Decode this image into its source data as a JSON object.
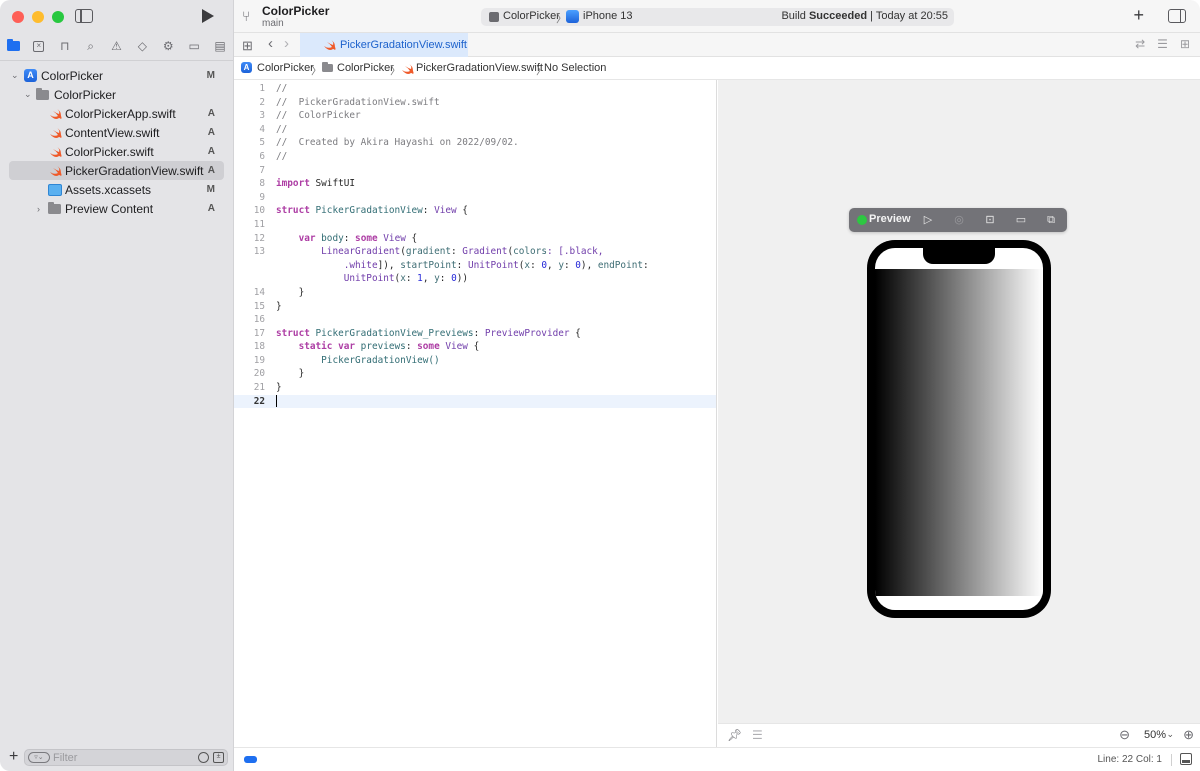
{
  "window": {
    "traffic_lights": [
      "close",
      "minimize",
      "zoom"
    ]
  },
  "toolbar": {
    "project_title": "ColorPicker",
    "branch": "main",
    "scheme": "ColorPicker",
    "device": "iPhone 13",
    "build_prefix": "Build ",
    "build_result": "Succeeded",
    "build_time": " | Today at 20:55",
    "add_label": "+"
  },
  "navigator": {
    "icons": [
      "folder-icon",
      "source-control-icon",
      "symbol-icon",
      "search-icon",
      "issue-icon",
      "test-icon",
      "debug-icon",
      "breakpoint-icon",
      "report-icon"
    ],
    "tree": [
      {
        "label": "ColorPicker",
        "badge": "M",
        "kind": "project",
        "level": 0,
        "expanded": true
      },
      {
        "label": "ColorPicker",
        "badge": "",
        "kind": "folder",
        "level": 1,
        "expanded": true
      },
      {
        "label": "ColorPickerApp.swift",
        "badge": "A",
        "kind": "swift",
        "level": 2
      },
      {
        "label": "ContentView.swift",
        "badge": "A",
        "kind": "swift",
        "level": 2
      },
      {
        "label": "ColorPicker.swift",
        "badge": "A",
        "kind": "swift",
        "level": 2
      },
      {
        "label": "PickerGradationView.swift",
        "badge": "A",
        "kind": "swift",
        "level": 2,
        "selected": true
      },
      {
        "label": "Assets.xcassets",
        "badge": "M",
        "kind": "assets",
        "level": 2
      },
      {
        "label": "Preview Content",
        "badge": "A",
        "kind": "folder",
        "level": 2,
        "expanded": false
      }
    ],
    "filter_placeholder": "Filter"
  },
  "tabs": [
    {
      "label": "PickerGradationView.swift",
      "active": true
    }
  ],
  "jumpbar": {
    "items": [
      "ColorPicker",
      "ColorPicker",
      "PickerGradationView.swift",
      "No Selection"
    ]
  },
  "editor": {
    "current_line": 22,
    "lines": [
      {
        "n": "1"
      },
      {
        "n": "2"
      },
      {
        "n": "3"
      },
      {
        "n": "4"
      },
      {
        "n": "5"
      },
      {
        "n": "6"
      },
      {
        "n": "7"
      },
      {
        "n": "8"
      },
      {
        "n": "9"
      },
      {
        "n": "10"
      },
      {
        "n": "11"
      },
      {
        "n": "12"
      },
      {
        "n": "13"
      },
      {
        "n": ""
      },
      {
        "n": ""
      },
      {
        "n": "14"
      },
      {
        "n": "15"
      },
      {
        "n": "16"
      },
      {
        "n": "17"
      },
      {
        "n": "18"
      },
      {
        "n": "19"
      },
      {
        "n": "20"
      },
      {
        "n": "21"
      },
      {
        "n": "22"
      }
    ],
    "tokens": {
      "c1": "//",
      "c2": "//  PickerGradationView.swift",
      "c3": "//  ColorPicker",
      "c4": "//",
      "c5": "//  Created by Akira Hayashi on 2022/09/02.",
      "c6": "//",
      "import_kw": "import",
      "import_mod": " SwiftUI",
      "struct_kw": "struct",
      "struct_name": " PickerGradationView",
      "colon_sp": ": ",
      "view_ty": "View",
      "brace_open": " {",
      "var_kw": "    var",
      "body_name": " body",
      "some_kw": "some",
      "lg": "        LinearGradient",
      "lg_paren": "(",
      "gradient_lbl": "gradient",
      "gradient_ty": "Gradient",
      "colors_lbl": "colors",
      "black": ": [.black,",
      "white_ind": "            .white",
      "white_close": "]), ",
      "startpoint_lbl": "startPoint",
      "unitpoint_ty": "UnitPoint",
      "x_lbl": "x",
      "y_lbl": "y",
      "zero": "0",
      "one": "1",
      "endpoint_lbl": "endPoint",
      "up2_ind": "            ",
      "close14": "    }",
      "close15": "}",
      "struct2_name": " PickerGradationView_Previews",
      "previewprovider_ty": "PreviewProvider",
      "static_kw": "    static",
      "var2_kw": " var",
      "previews_name": " previews",
      "pgv_call": "        PickerGradationView()",
      "close20": "    }",
      "close21": "}"
    }
  },
  "preview": {
    "label": "Preview",
    "status_color": "#2dc742",
    "tools": [
      "live-preview-icon",
      "selectable-icon",
      "rotate-icon",
      "device-settings-icon",
      "duplicate-icon"
    ],
    "gradient_colors": [
      "#000000",
      "#ffffff"
    ]
  },
  "canvas_bottom": {
    "zoom_level": "50%"
  },
  "statusbar": {
    "cursor_position": "Line: 22  Col: 1"
  }
}
